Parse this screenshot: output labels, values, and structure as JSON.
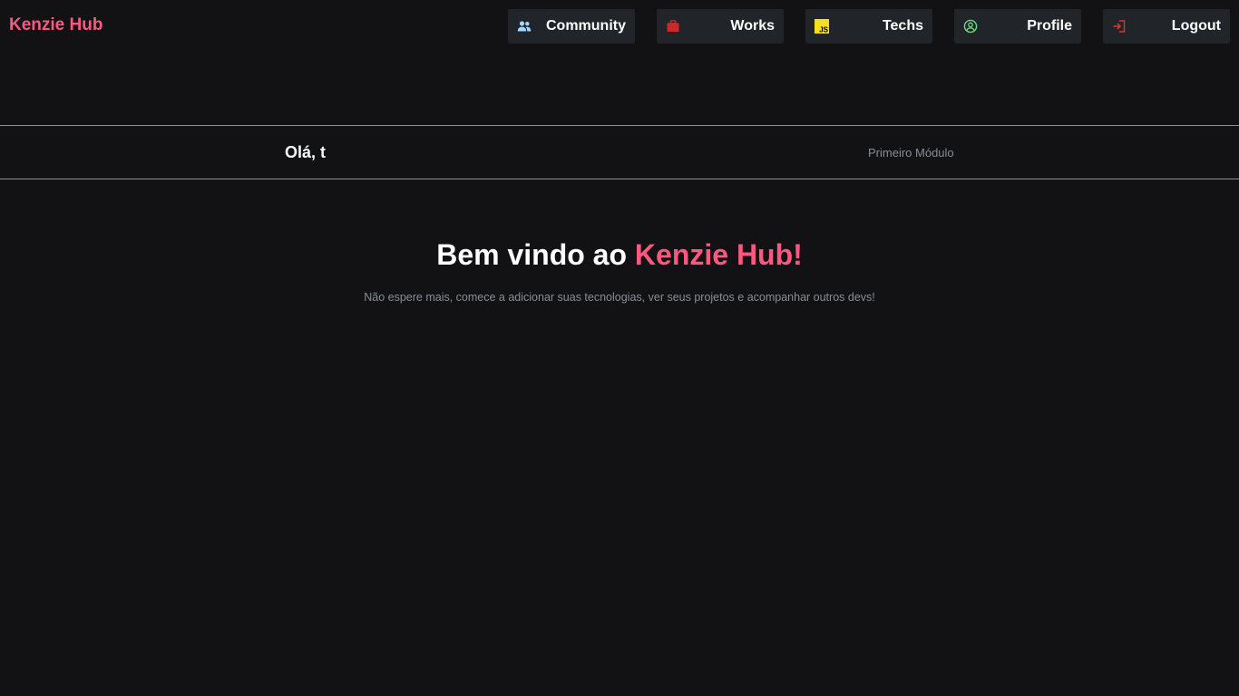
{
  "header": {
    "logo": "Kenzie Hub",
    "nav": {
      "community": {
        "label": "Community",
        "icon": "people-icon"
      },
      "works": {
        "label": "Works",
        "icon": "briefcase-icon"
      },
      "techs": {
        "label": "Techs",
        "icon": "javascript-icon",
        "icon_text": "JS"
      },
      "profile": {
        "label": "Profile",
        "icon": "user-circle-icon"
      },
      "logout": {
        "label": "Logout",
        "icon": "logout-icon"
      }
    }
  },
  "greeting": {
    "text": "Olá, t",
    "module": "Primeiro Módulo"
  },
  "welcome": {
    "title_prefix": "Bem vindo ao ",
    "title_accent": "Kenzie Hub!",
    "subtitle": "Não espere mais, comece a adicionar suas tecnologias, ver seus projetos e acompanhar outros devs!"
  },
  "colors": {
    "background": "#121214",
    "accent": "#ff577f",
    "button_bg": "#212529",
    "muted_text": "#868e96",
    "community_icon": "#a5d8ff",
    "works_icon": "#c92a2a",
    "techs_icon": "#f7df1e",
    "profile_icon": "#69db7c",
    "logout_icon": "#e03131"
  }
}
